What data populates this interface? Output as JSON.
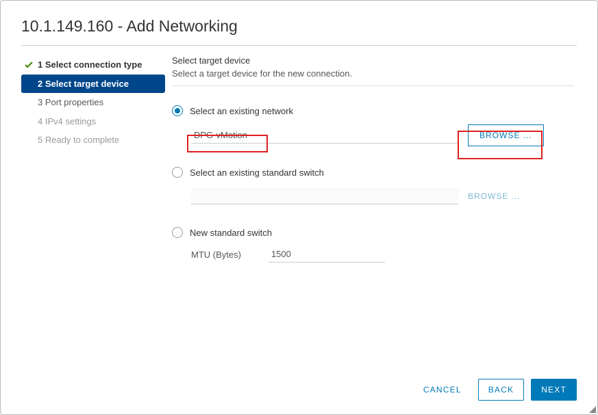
{
  "title": "10.1.149.160 - Add Networking",
  "steps": [
    {
      "label": "1 Select connection type",
      "state": "completed"
    },
    {
      "label": "2 Select target device",
      "state": "active"
    },
    {
      "label": "3 Port properties",
      "state": "enabled"
    },
    {
      "label": "4 IPv4 settings",
      "state": "disabled"
    },
    {
      "label": "5 Ready to complete",
      "state": "disabled"
    }
  ],
  "content": {
    "heading": "Select target device",
    "sub": "Select a target device for the new connection.",
    "option1": {
      "label": "Select an existing network",
      "value": "DPG-vMotion",
      "browse": "BROWSE ..."
    },
    "option2": {
      "label": "Select an existing standard switch",
      "value": "",
      "browse": "BROWSE ..."
    },
    "option3": {
      "label": "New standard switch",
      "mtu_label": "MTU (Bytes)",
      "mtu_value": "1500"
    }
  },
  "footer": {
    "cancel": "CANCEL",
    "back": "BACK",
    "next": "NEXT"
  }
}
